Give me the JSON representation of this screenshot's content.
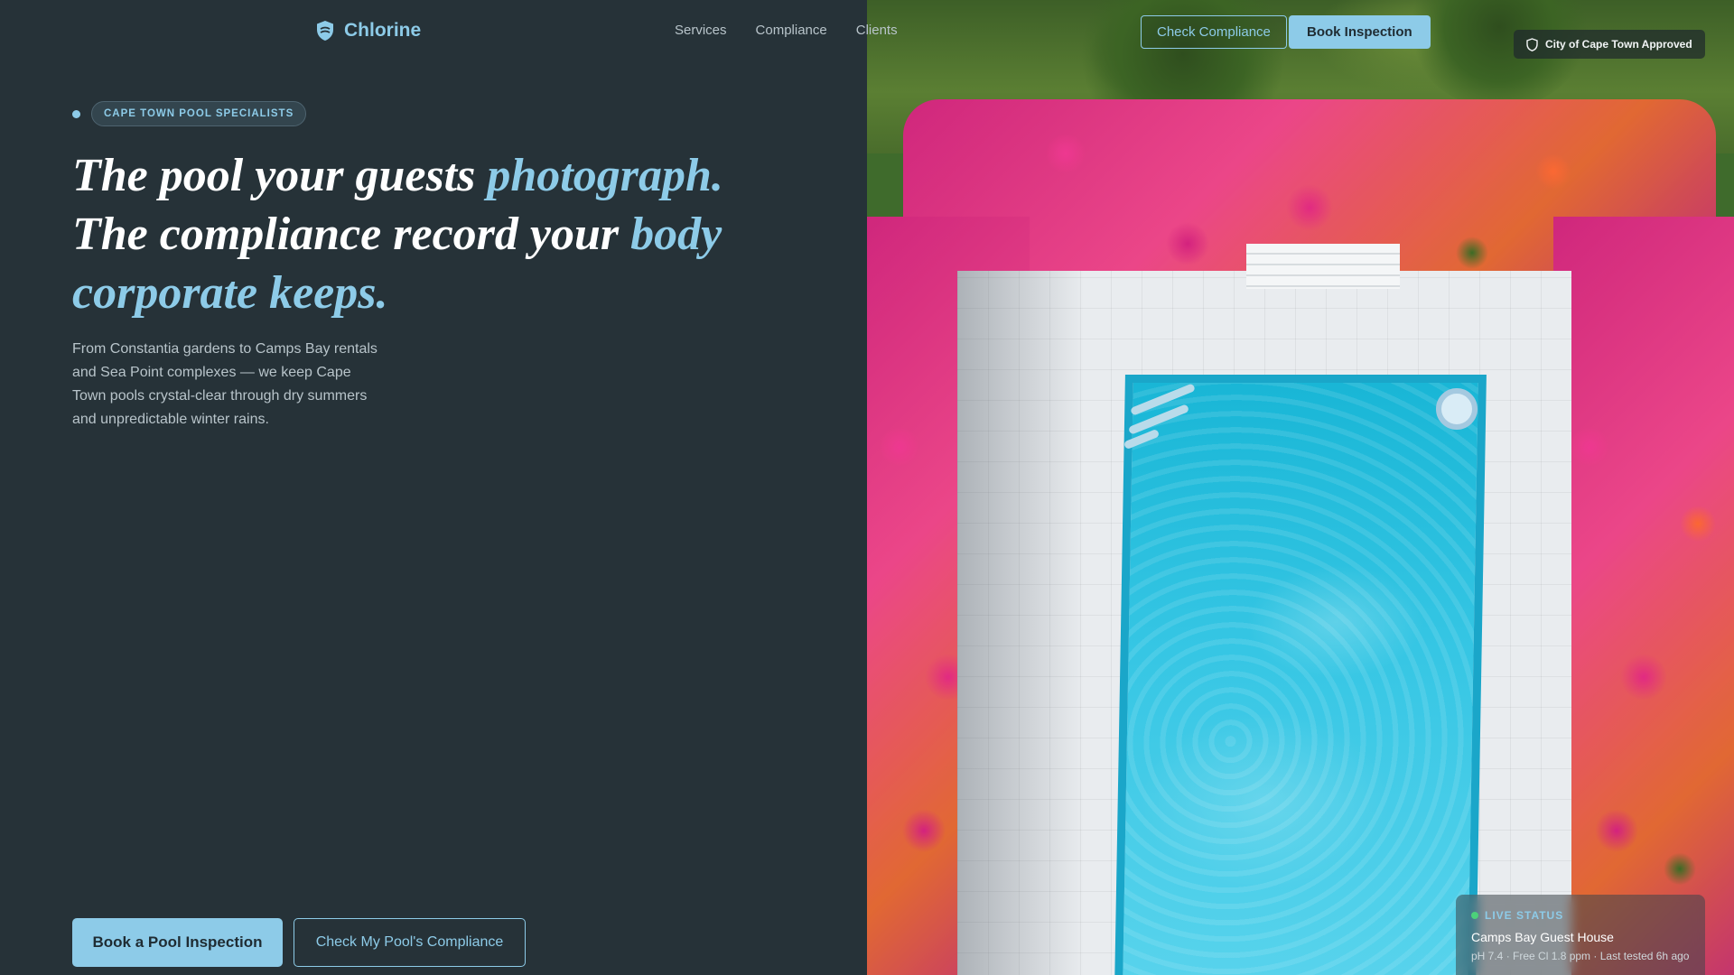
{
  "nav": {
    "brand_name": "Chlorine",
    "brand_icon": "shield-icon",
    "links": [
      {
        "label": "Services"
      },
      {
        "label": "Compliance"
      },
      {
        "label": "Clients"
      }
    ],
    "check_button": "Check Compliance",
    "book_button": "Book Inspection"
  },
  "badge": {
    "icon": "shield-icon",
    "label": "City of Cape Town Approved"
  },
  "hero": {
    "eyebrow": "CAPE TOWN POOL SPECIALISTS",
    "headline": {
      "l1a": "The pool your guests ",
      "l1b": "photograph.",
      "l2a": "The compliance record your ",
      "l2b": "body corporate keeps."
    },
    "lead": "From Constantia gardens to Camps Bay rentals and Sea Point complexes — we keep Cape Town pools crystal-clear through dry summers and unpredictable winter rains.",
    "cta_primary": "Book a Pool Inspection",
    "cta_secondary": "Check My Pool's Compliance"
  },
  "live_status": {
    "heading": "LIVE STATUS",
    "site": "Camps Bay Guest House",
    "reading": "pH 7.4 · Free Cl 1.8 ppm · Last tested 6h ago"
  },
  "colors": {
    "background": "#263238",
    "accent": "#8dcbe8",
    "live_indicator": "#4cd17a"
  }
}
